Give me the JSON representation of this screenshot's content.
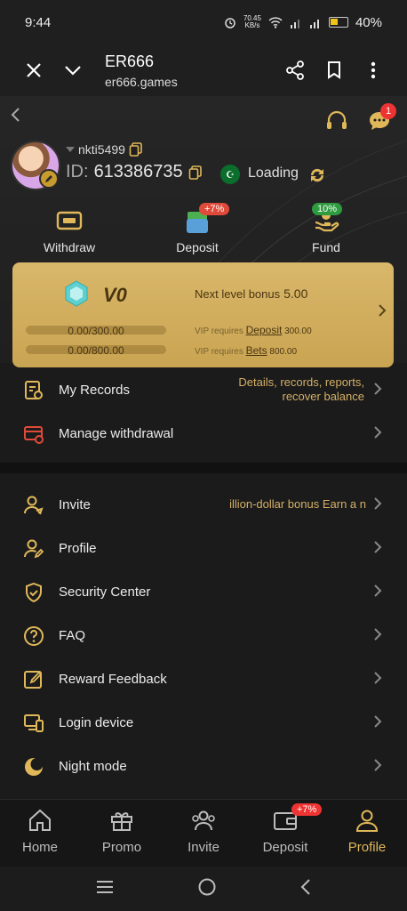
{
  "status": {
    "time": "9:44",
    "net_speed_value": "70.45",
    "net_speed_unit": "KB/s",
    "battery": "40%"
  },
  "browser": {
    "title": "ER666",
    "url": "er666.games"
  },
  "header": {
    "message_badge": "1",
    "username": "nkti5499",
    "id_label": "ID:",
    "id_value": "613386735",
    "loading_text": "Loading"
  },
  "quick_actions": [
    {
      "label": "Withdraw",
      "icon": "ticket-icon",
      "badge": ""
    },
    {
      "label": "Deposit",
      "icon": "wallet-icon",
      "badge": "+7%"
    },
    {
      "label": "Fund",
      "icon": "hand-icon",
      "badge": "10%"
    }
  ],
  "vip": {
    "level": "V0",
    "next_bonus_label": "Next level bonus",
    "next_bonus_value": "5.00",
    "deposit_progress": "0.00/300.00",
    "bets_progress": "0.00/800.00",
    "deposit_req_prefix": "VIP requires",
    "deposit_req_link": "Deposit",
    "deposit_req_amount": "300.00",
    "bets_req_prefix": "VIP requires",
    "bets_req_link": "Bets",
    "bets_req_amount": "800.00"
  },
  "menu_top": [
    {
      "label": "My Records",
      "extra_line1": "Details, records, reports,",
      "extra_line2": "recover balance"
    },
    {
      "label": "Manage withdrawal",
      "extra_line1": "",
      "extra_line2": ""
    }
  ],
  "menu_main": [
    {
      "label": "Invite",
      "extra": "illion-dollar bonus  Earn a n"
    },
    {
      "label": "Profile",
      "extra": ""
    },
    {
      "label": "Security Center",
      "extra": ""
    },
    {
      "label": "FAQ",
      "extra": ""
    },
    {
      "label": "Reward Feedback",
      "extra": ""
    },
    {
      "label": "Login device",
      "extra": ""
    },
    {
      "label": "Night mode",
      "extra": ""
    }
  ],
  "bottom_nav": [
    {
      "label": "Home",
      "badge": ""
    },
    {
      "label": "Promo",
      "badge": ""
    },
    {
      "label": "Invite",
      "badge": ""
    },
    {
      "label": "Deposit",
      "badge": "+7%"
    },
    {
      "label": "Profile",
      "badge": ""
    }
  ],
  "colors": {
    "accent": "#e0b85a",
    "vip_card": "#d4b062",
    "badge": "#e33333"
  }
}
